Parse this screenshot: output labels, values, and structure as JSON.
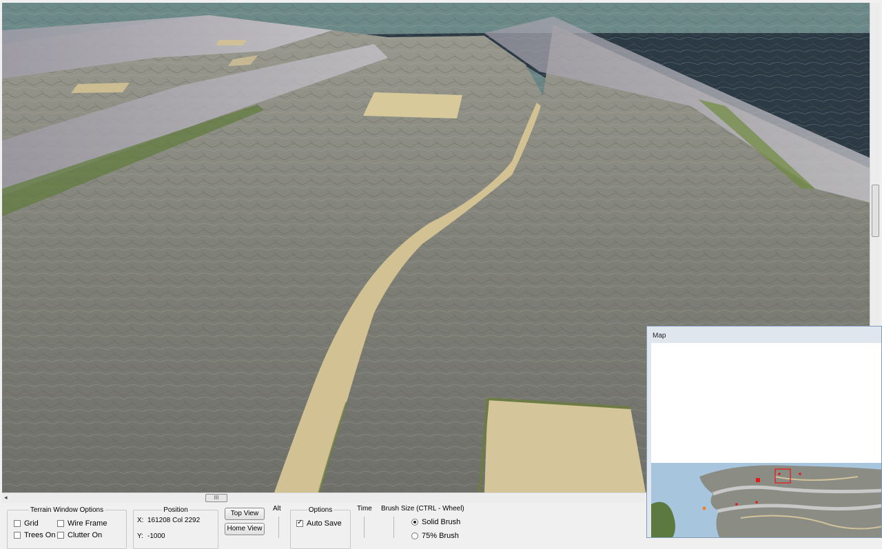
{
  "terrain_options": {
    "legend": "Terrain Window Options",
    "grid_label": "Grid",
    "grid_checked": false,
    "wireframe_label": "Wire Frame",
    "wireframe_checked": false,
    "trees_label": "Trees On",
    "trees_checked": false,
    "clutter_label": "Clutter On",
    "clutter_checked": false
  },
  "position": {
    "legend": "Position",
    "x_label": "X:",
    "x_value": "161208 Col 2292",
    "y_label": "Y:",
    "y_value": "-1000"
  },
  "view_buttons": {
    "top_view": "Top View",
    "home_view": "Home View"
  },
  "alt_label": "Alt",
  "options": {
    "legend": "Options",
    "auto_save_label": "Auto Save",
    "auto_save_checked": true
  },
  "time_label": "Time",
  "brush": {
    "title": "Brush Size (CTRL - Wheel)",
    "solid_label": "Solid Brush",
    "solid_selected": true,
    "pct_label": "75% Brush",
    "pct_selected": false
  },
  "map_window": {
    "title": "Map"
  },
  "scrollbar": {
    "thumb_grip": "III",
    "left_arrow": "◂"
  },
  "colors": {
    "sky": "#5b7576",
    "water": "#2b3a45",
    "terrain": "#8a8a80",
    "path": "#d2c193",
    "grass": "#6f7f45",
    "map_water": "#a8c5de",
    "map_marker": "#e31b1b"
  }
}
